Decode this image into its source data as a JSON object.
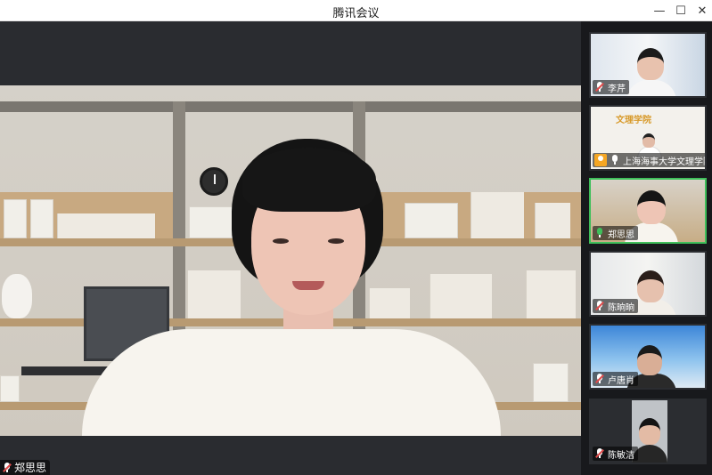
{
  "window": {
    "title": "腾讯会议",
    "controls": {
      "minimize": "—",
      "maximize": "☐",
      "close": "✕"
    }
  },
  "main_video": {
    "speaker_name": "郑思思",
    "mic_state": "muted"
  },
  "participants": [
    {
      "name": "李芹",
      "mic_state": "muted",
      "active": false
    },
    {
      "name": "上海海事大学文理学院",
      "mic_state": "on",
      "active": false,
      "badge": "host",
      "banner_text": "文理学院"
    },
    {
      "name": "郑思思",
      "mic_state": "speaking",
      "active": true
    },
    {
      "name": "陈晌晌",
      "mic_state": "muted",
      "active": false
    },
    {
      "name": "卢唐肖",
      "mic_state": "muted",
      "active": false
    },
    {
      "name": "陈敏洁",
      "mic_state": "muted",
      "active": false
    }
  ],
  "colors": {
    "active_border": "#3fbf5a",
    "muted_mic": "#e04b4b",
    "host_badge": "#f5a623"
  }
}
